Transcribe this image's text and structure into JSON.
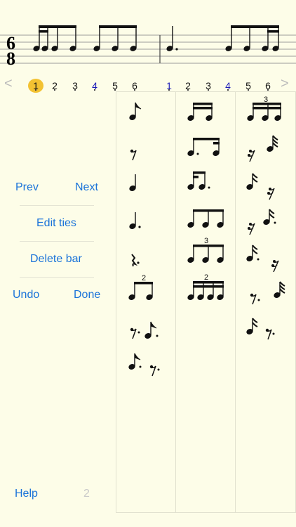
{
  "time_signature": {
    "top": "6",
    "bottom": "8"
  },
  "nav": {
    "prev_arrow": "<",
    "next_arrow": ">"
  },
  "beats_bar1": [
    "1",
    "2",
    "3",
    "4",
    "5",
    "6"
  ],
  "beats_bar2": [
    "1",
    "2",
    "3",
    "4",
    "5",
    "6"
  ],
  "current_beat": "1",
  "accent_color": "#f3c232",
  "link_color": "#1a73d9",
  "buttons": {
    "prev": "Prev",
    "next": "Next",
    "edit_ties": "Edit ties",
    "delete_bar": "Delete bar",
    "undo": "Undo",
    "done": "Done",
    "help": "Help"
  },
  "page_number": "2",
  "palette": {
    "col1": [
      "eighth-note",
      "eighth-rest",
      "quarter-note",
      "dotted-quarter-note",
      "dotted-quarter-rest",
      "eighth-duplet",
      "dotted-eighth-rest-dotted-eighth-note",
      "dotted-eighth-note-dotted-eighth-rest"
    ],
    "col2": [
      "two-sixteenths",
      "dotted-eighth-sixteenth",
      "sixteenth-dotted-eighth",
      "three-eighths",
      "eighth-triplet",
      "sixteenth-quadruplet"
    ],
    "col3": [
      "sixteenth-triplet",
      "sixteenth-rest-thirtysecond-note",
      "sixteenth-note-sixteenth-rest",
      "sixteenth-rest-dotted-sixteenth-note",
      "dotted-sixteenth-note-sixteenth-rest",
      "eighth-rest-thirtysecond-note",
      "sixteenth-note-eighth-rest"
    ],
    "tuplet_labels": {
      "duplet": "2",
      "triplet": "3",
      "quadruplet": "2",
      "sixteenth_triplet": "3"
    }
  }
}
